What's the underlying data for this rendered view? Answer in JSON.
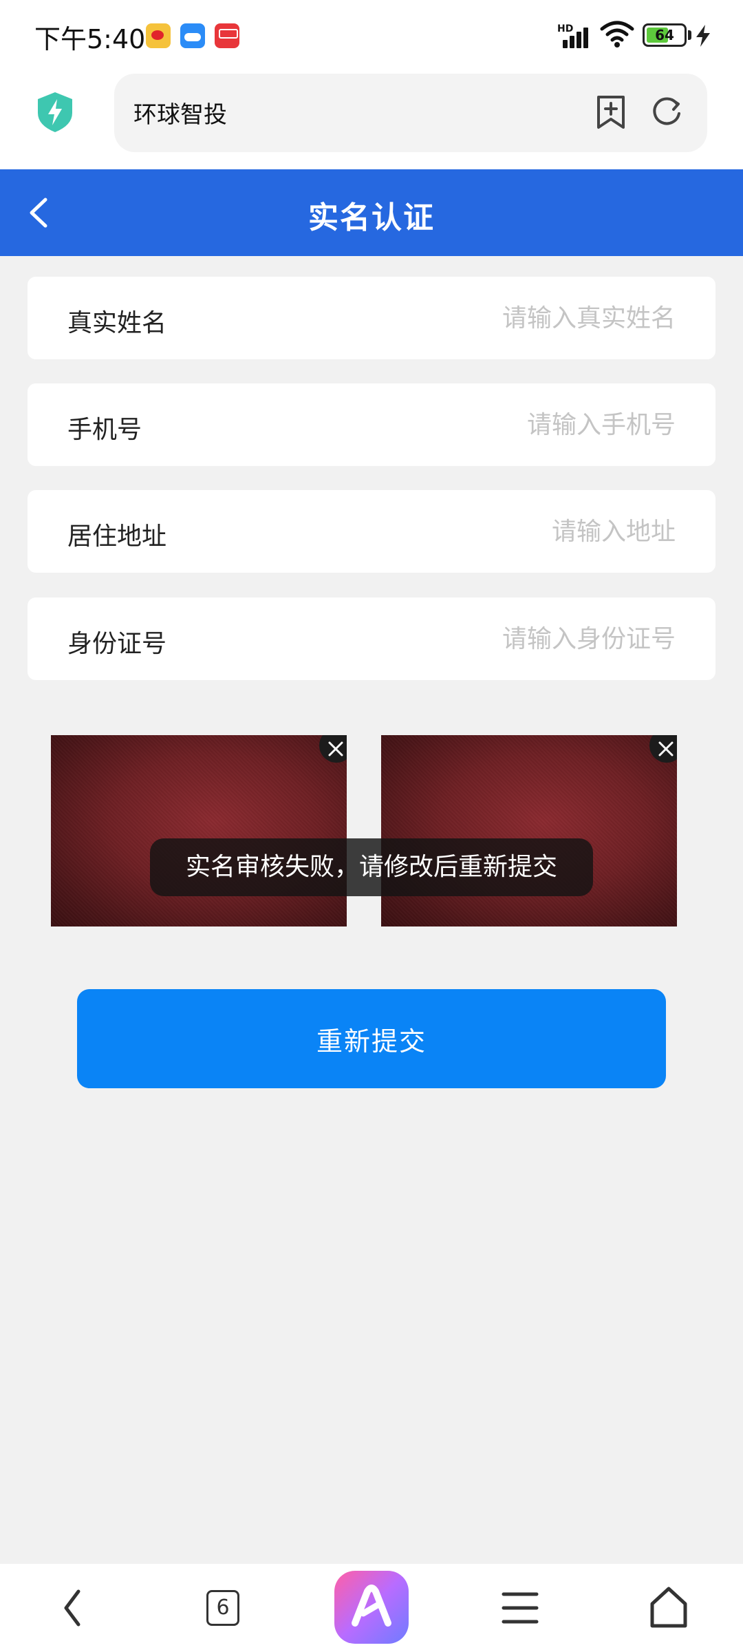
{
  "status_bar": {
    "time": "下午5:40",
    "notifications": [
      "weibo-icon",
      "cloud-icon",
      "red-app-icon"
    ],
    "network_label": "HD",
    "battery": "64",
    "battery_fraction": 0.64
  },
  "browser": {
    "url_title": "环球智投",
    "icons": [
      "shield-icon",
      "bookmark-add-icon",
      "refresh-icon"
    ]
  },
  "header": {
    "title": "实名认证",
    "background": "#2668e0"
  },
  "form": {
    "fields": [
      {
        "label": "真实姓名",
        "value": "",
        "placeholder": "请输入真实姓名"
      },
      {
        "label": "手机号",
        "value": "",
        "placeholder": "请输入手机号"
      },
      {
        "label": "居住地址",
        "value": "",
        "placeholder": "请输入地址"
      },
      {
        "label": "身份证号",
        "value": "",
        "placeholder": "请输入身份证号"
      }
    ]
  },
  "toast": {
    "message": "实名审核失败，请修改后重新提交"
  },
  "submit": {
    "label": "重新提交",
    "color": "#0a84f6"
  },
  "bottom_nav": {
    "tab_count": "6",
    "items": [
      "back-icon",
      "tabs-icon",
      "ai-assistant-icon",
      "menu-icon",
      "home-icon"
    ]
  }
}
